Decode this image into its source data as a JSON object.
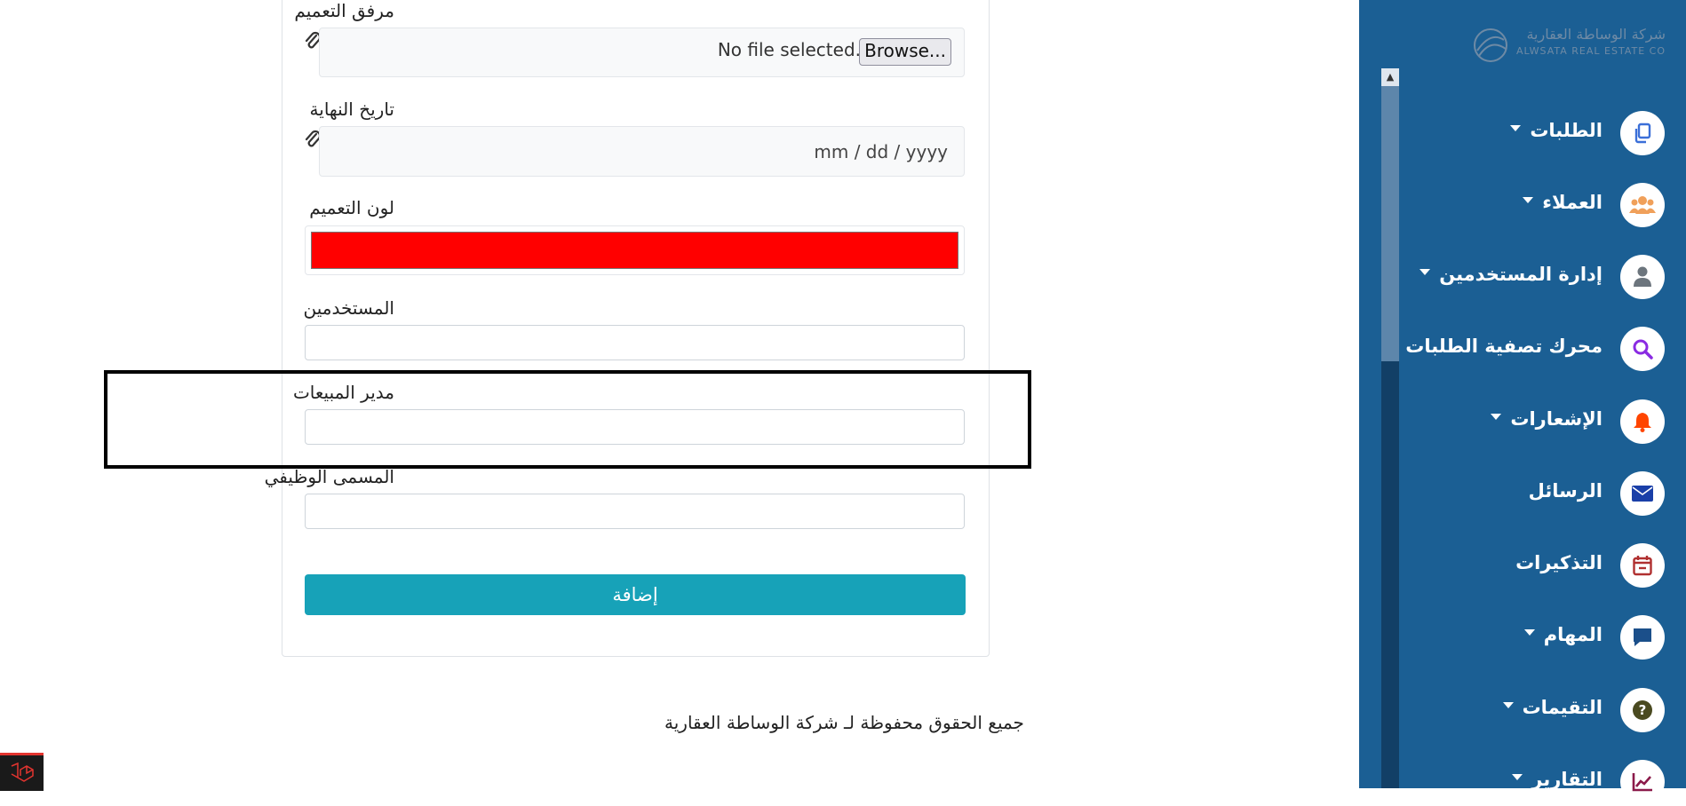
{
  "form": {
    "attachment_label": "مرفق التعميم",
    "browse_button": "Browse...",
    "no_file_text": "No file selected.",
    "end_date_label": "تاريخ النهاية",
    "date_placeholder": "mm / dd / yyyy",
    "color_label": "لون التعميم",
    "color_value": "#ff0000",
    "users_label": "المستخدمين",
    "users_value": "",
    "sales_manager_label": "مدير المبيعات",
    "sales_manager_value": "",
    "job_title_label": "المسمى الوظيفي",
    "job_title_value": "",
    "submit_label": "إضافة"
  },
  "footer": {
    "copyright": "جميع الحقوق محفوظة لـ شركة الوساطة العقارية"
  },
  "sidebar": {
    "logo_ar": "شركة الوساطة العقارية",
    "logo_en": "ALWSATA REAL ESTATE CO",
    "items": [
      {
        "label": "الطلبات",
        "icon": "copy-icon",
        "has_caret": true,
        "icon_color": "#3b6fd8"
      },
      {
        "label": "العملاء",
        "icon": "users-icon",
        "has_caret": true,
        "icon_color": "#f0a05a"
      },
      {
        "label": "إدارة المستخدمين",
        "icon": "user-icon",
        "has_caret": true,
        "icon_color": "#6c757d"
      },
      {
        "label": "محرك تصفية الطلبات",
        "icon": "search-icon",
        "has_caret": false,
        "icon_color": "#8a2be2"
      },
      {
        "label": "الإشعارات",
        "icon": "bell-icon",
        "has_caret": true,
        "icon_color": "#ff4500"
      },
      {
        "label": "الرسائل",
        "icon": "envelope-icon",
        "has_caret": false,
        "icon_color": "#1a3fa8"
      },
      {
        "label": "التذكيرات",
        "icon": "calendar-icon",
        "has_caret": false,
        "icon_color": "#b03030"
      },
      {
        "label": "المهام",
        "icon": "comment-icon",
        "has_caret": true,
        "icon_color": "#1b4f8a"
      },
      {
        "label": "التقيمات",
        "icon": "question-circle-icon",
        "has_caret": true,
        "icon_color": "#4a4a20"
      },
      {
        "label": "التقارير",
        "icon": "chart-icon",
        "has_caret": true,
        "icon_color": "#8b1a4a"
      }
    ]
  },
  "colors": {
    "sidebar_bg": "#1b5f94",
    "submit_bg": "#17a2b8"
  }
}
